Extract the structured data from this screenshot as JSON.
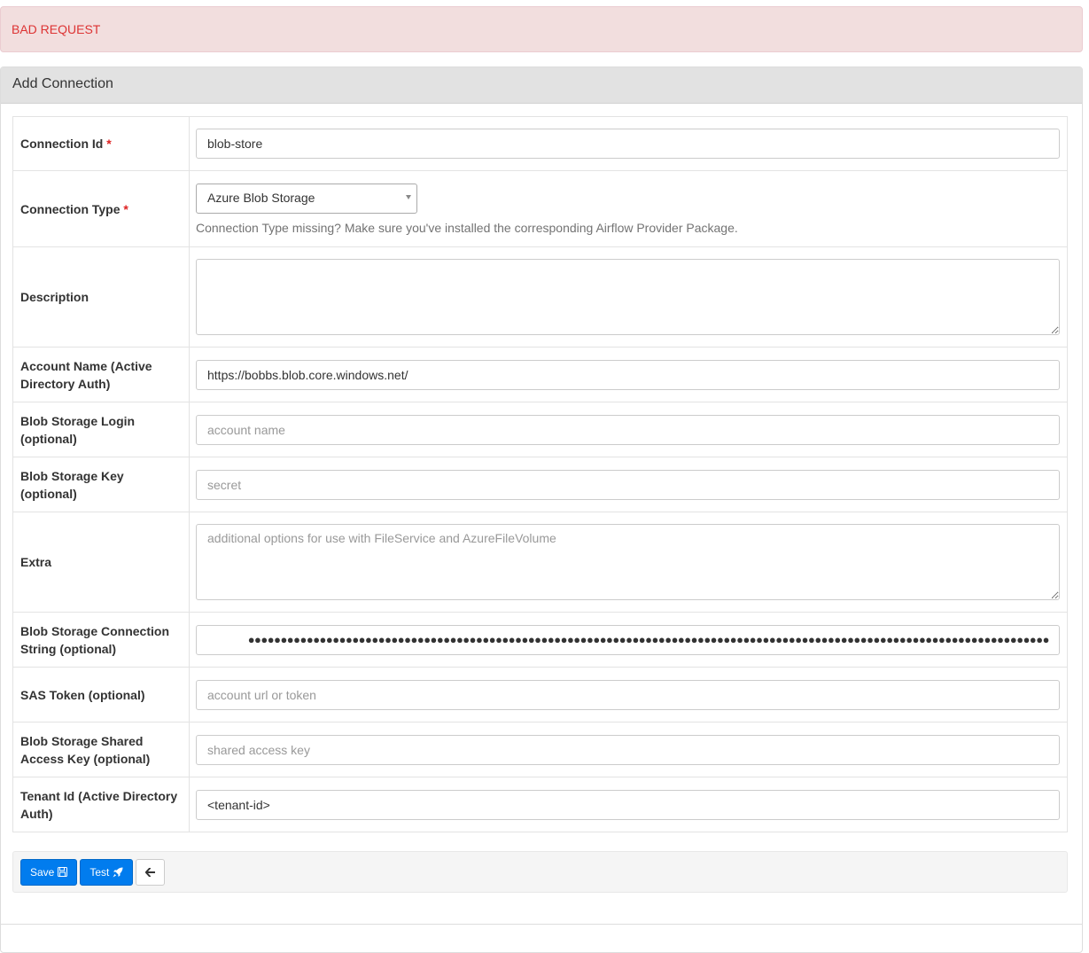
{
  "alert": {
    "text": "BAD REQUEST"
  },
  "panel": {
    "title": "Add Connection"
  },
  "form": {
    "connection_id": {
      "label": "Connection Id",
      "required_mark": "*",
      "value": "blob-store"
    },
    "connection_type": {
      "label": "Connection Type",
      "required_mark": "*",
      "selected": "Azure Blob Storage",
      "help": "Connection Type missing? Make sure you've installed the corresponding Airflow Provider Package."
    },
    "description": {
      "label": "Description",
      "value": "",
      "placeholder": ""
    },
    "account_name": {
      "label": "Account Name (Active Directory Auth)",
      "value": "https://bobbs.blob.core.windows.net/"
    },
    "login": {
      "label": "Blob Storage Login (optional)",
      "value": "",
      "placeholder": "account name"
    },
    "key": {
      "label": "Blob Storage Key (optional)",
      "value": "",
      "placeholder": "secret"
    },
    "extra": {
      "label": "Extra",
      "value": "",
      "placeholder": "additional options for use with FileService and AzureFileVolume"
    },
    "connection_string": {
      "label": "Blob Storage Connection String (optional)",
      "masked_value": "●●●●●●●●●●●●●●●●●●●●●●●●●●●●●●●●●●●●●●●●●●●●●●●●●●●●●●●●●●●●●●●●●●●●●●●●●●●●●●●●●●●●●●●●●●●●●●●●●●●●●●●●●●●●●●●●●●●●●●●●●●●"
    },
    "sas_token": {
      "label": "SAS Token (optional)",
      "value": "",
      "placeholder": "account url or token"
    },
    "shared_access_key": {
      "label": "Blob Storage Shared Access Key (optional)",
      "value": "",
      "placeholder": "shared access key"
    },
    "tenant_id": {
      "label": "Tenant Id (Active Directory Auth)",
      "value": "<tenant-id>"
    }
  },
  "actions": {
    "save_label": "Save",
    "save_icon": "save-icon",
    "test_label": "Test",
    "test_icon": "rocket-icon",
    "back_icon": "arrow-left-icon"
  },
  "colors": {
    "primary": "#017cee",
    "alert_bg": "#f2dede",
    "alert_text": "#dd3333",
    "required": "#dd2222"
  }
}
